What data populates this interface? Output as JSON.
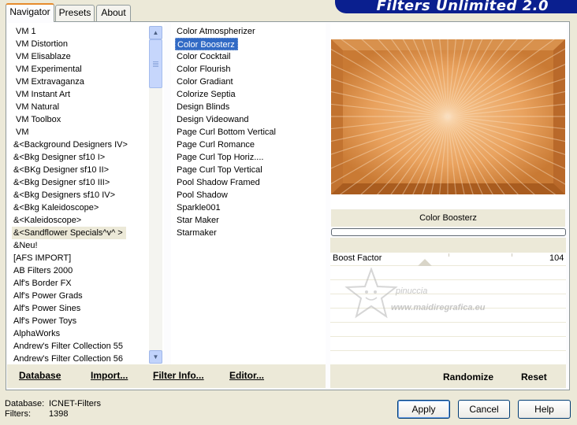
{
  "window": {
    "banner_title": "Filters Unlimited 2.0"
  },
  "tabs": [
    {
      "label": "Navigator",
      "active": true
    },
    {
      "label": "Presets",
      "active": false
    },
    {
      "label": "About",
      "active": false
    }
  ],
  "categories": [
    "VM 1",
    "VM Distortion",
    "VM Elisablaze",
    "VM Experimental",
    "VM Extravaganza",
    "VM Instant Art",
    "VM Natural",
    "VM Toolbox",
    "VM",
    "&<Background Designers IV>",
    "&<Bkg Designer sf10 I>",
    "&<BKg Designer sf10 II>",
    "&<Bkg Designer sf10 III>",
    "&<Bkg Designers sf10 IV>",
    "&<Bkg Kaleidoscope>",
    "&<Kaleidoscope>",
    "&<Sandflower Specials^v^ >",
    "&Neu!",
    "[AFS IMPORT]",
    "AB Filters 2000",
    "Alf's Border FX",
    "Alf's Power Grads",
    "Alf's Power Sines",
    "Alf's Power Toys",
    "AlphaWorks",
    "Andrew's Filter Collection 55",
    "Andrew's Filter Collection 56"
  ],
  "highlighted_category": "&<Sandflower Specials^v^ >",
  "filters": [
    "Color Atmospherizer",
    "Color Boosterz",
    "Color Cocktail",
    "Color Flourish",
    "Color Gradiant",
    "Colorize Septia",
    "Design Blinds",
    "Design Videowand",
    "Page Curl Bottom Vertical",
    "Page Curl Romance",
    "Page Curl Top Horiz....",
    "Page Curl Top Vertical",
    "Pool Shadow Framed",
    "Pool Shadow",
    "Sparkle001",
    "Star Maker",
    "Starmaker"
  ],
  "selected_filter": "Color Boosterz",
  "bottom_links": {
    "database": "Database",
    "import": "Import...",
    "filter_info": "Filter Info...",
    "editor": "Editor..."
  },
  "control": {
    "filter_name": "Color Boosterz",
    "param_label": "Boost Factor",
    "param_value": "104",
    "randomize": "Randomize",
    "reset": "Reset"
  },
  "watermark": {
    "line1": "pinuccia",
    "line2": "www.maidiregrafica.eu"
  },
  "status": {
    "database_label": "Database:",
    "database_value": "ICNET-Filters",
    "filters_label": "Filters:",
    "filters_value": "1398"
  },
  "buttons": {
    "apply": "Apply",
    "cancel": "Cancel",
    "help": "Help"
  },
  "colors": {
    "selection": "#316ac5",
    "banner": "#0a1f8f",
    "preview_orange": "#cd8038"
  }
}
